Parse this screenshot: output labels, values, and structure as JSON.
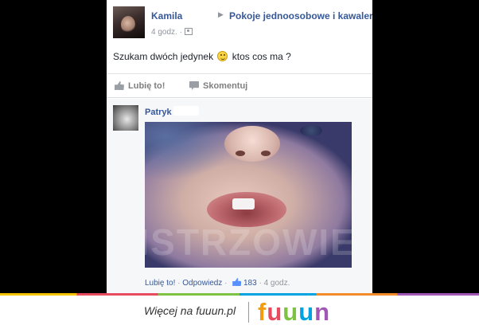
{
  "post": {
    "author": "Kamila",
    "group": "Pokoje jednoosobowe i kawalerki",
    "time": "4 godz.",
    "text_before": "Szukam dwóch jedynek",
    "text_after": "ktos cos ma ?",
    "actions": {
      "like": "Lubię to!",
      "comment": "Skomentuj"
    }
  },
  "comment": {
    "author": "Patryk",
    "watermark": "MISTRZOWIE",
    "actions": {
      "like": "Lubię to!",
      "separator": "·",
      "reply": "Odpowiedz",
      "separator2": "·",
      "likes_count": "183",
      "separator3": "·",
      "time": "4 godz."
    }
  },
  "footer": {
    "text": "Więcej na fuuun.pl",
    "logo_letters": [
      "f",
      "u",
      "u",
      "u",
      "n"
    ],
    "logo_colors": [
      "#f39c12",
      "#e84a5f",
      "#7dc242",
      "#00a3e0",
      "#a157b5"
    ]
  }
}
